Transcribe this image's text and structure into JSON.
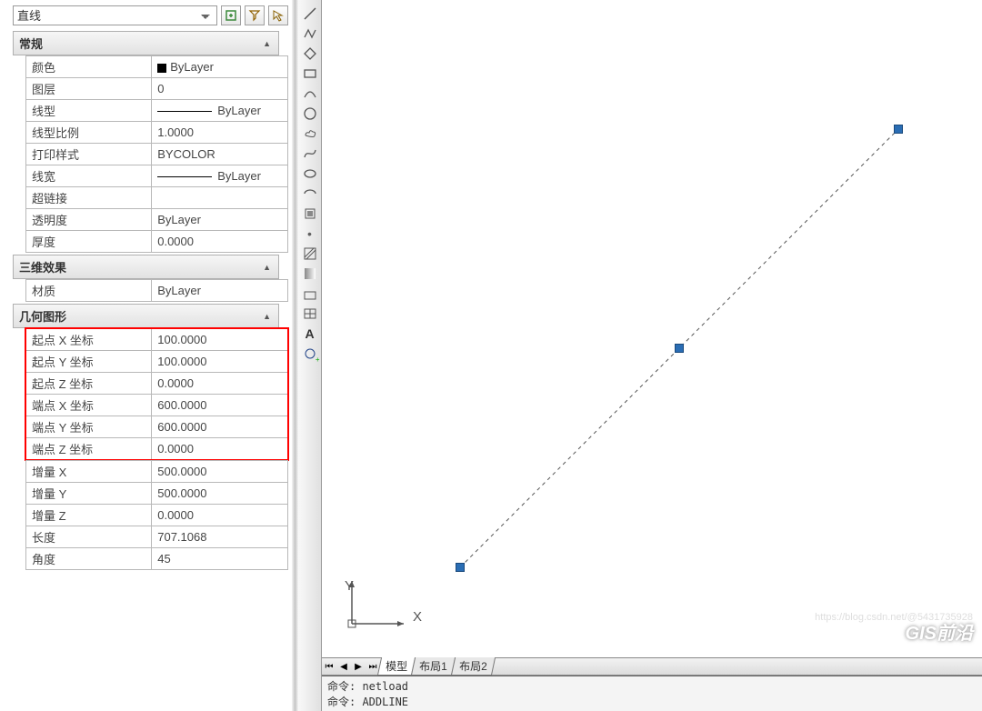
{
  "selector": {
    "value": "直线"
  },
  "sections": {
    "general": {
      "title": "常规",
      "rows": {
        "color_label": "颜色",
        "color_value": "ByLayer",
        "layer_label": "图层",
        "layer_value": "0",
        "linetype_label": "线型",
        "linetype_value": "ByLayer",
        "ltscale_label": "线型比例",
        "ltscale_value": "1.0000",
        "plotstyle_label": "打印样式",
        "plotstyle_value": "BYCOLOR",
        "lineweight_label": "线宽",
        "lineweight_value": "ByLayer",
        "hyperlink_label": "超链接",
        "hyperlink_value": "",
        "transparency_label": "透明度",
        "transparency_value": "ByLayer",
        "thickness_label": "厚度",
        "thickness_value": "0.0000"
      }
    },
    "effects3d": {
      "title": "三维效果",
      "rows": {
        "material_label": "材质",
        "material_value": "ByLayer"
      }
    },
    "geometry": {
      "title": "几何图形",
      "rows": {
        "startx_label": "起点 X 坐标",
        "startx_value": "100.0000",
        "starty_label": "起点 Y 坐标",
        "starty_value": "100.0000",
        "startz_label": "起点 Z 坐标",
        "startz_value": "0.0000",
        "endx_label": "端点 X 坐标",
        "endx_value": "600.0000",
        "endy_label": "端点 Y 坐标",
        "endy_value": "600.0000",
        "endz_label": "端点 Z 坐标",
        "endz_value": "0.0000",
        "deltax_label": "增量 X",
        "deltax_value": "500.0000",
        "deltay_label": "增量 Y",
        "deltay_value": "500.0000",
        "deltaz_label": "增量 Z",
        "deltaz_value": "0.0000",
        "length_label": "长度",
        "length_value": "707.1068",
        "angle_label": "角度",
        "angle_value": "45"
      }
    }
  },
  "axes": {
    "x": "X",
    "y": "Y"
  },
  "tabs": {
    "model": "模型",
    "layout1": "布局1",
    "layout2": "布局2"
  },
  "commands": {
    "line1": "命令: netload",
    "line2": "命令: ADDLINE"
  },
  "watermark": "GIS前沿",
  "faint_url": "https://blog.csdn.net/@5431735928"
}
